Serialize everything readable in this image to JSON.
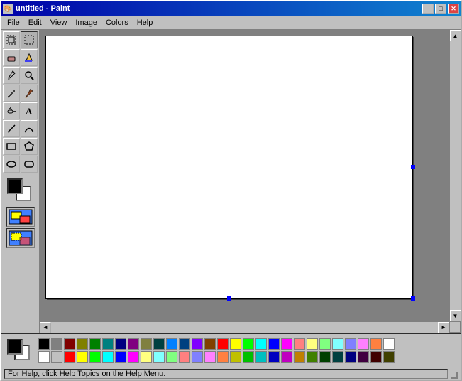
{
  "window": {
    "title": "untitled - Paint",
    "icon": "🎨"
  },
  "title_buttons": {
    "minimize": "—",
    "maximize": "□",
    "close": "✕"
  },
  "menu": {
    "items": [
      "File",
      "Edit",
      "View",
      "Image",
      "Colors",
      "Help"
    ]
  },
  "tools": [
    {
      "name": "free-select",
      "icon": "⬡",
      "title": "Free Select"
    },
    {
      "name": "rect-select",
      "icon": "⬜",
      "title": "Rectangular Select"
    },
    {
      "name": "eraser",
      "icon": "◻",
      "title": "Eraser"
    },
    {
      "name": "fill",
      "icon": "🪣",
      "title": "Fill"
    },
    {
      "name": "eyedropper",
      "icon": "💉",
      "title": "Pick Color"
    },
    {
      "name": "magnify",
      "icon": "🔍",
      "title": "Magnify"
    },
    {
      "name": "pencil",
      "icon": "✏",
      "title": "Pencil"
    },
    {
      "name": "brush",
      "icon": "🖌",
      "title": "Brush"
    },
    {
      "name": "airbrush",
      "icon": "💨",
      "title": "Airbrush"
    },
    {
      "name": "text",
      "icon": "A",
      "title": "Text"
    },
    {
      "name": "line",
      "icon": "╱",
      "title": "Line"
    },
    {
      "name": "curve",
      "icon": "∿",
      "title": "Curve"
    },
    {
      "name": "rect-shape",
      "icon": "▭",
      "title": "Rectangle"
    },
    {
      "name": "polygon",
      "icon": "⬠",
      "title": "Polygon"
    },
    {
      "name": "ellipse",
      "icon": "⬭",
      "title": "Ellipse"
    },
    {
      "name": "rounded-rect",
      "icon": "▢",
      "title": "Rounded Rectangle"
    }
  ],
  "active_tool": "rect-select",
  "foreground_color": "#000000",
  "background_color": "#ffffff",
  "palette_row1": [
    "#000000",
    "#808080",
    "#800000",
    "#808000",
    "#008000",
    "#008080",
    "#000080",
    "#800080",
    "#808040",
    "#004040",
    "#0080ff",
    "#004080",
    "#8000ff",
    "#804000",
    "#ff0000",
    "#ffff00",
    "#00ff00",
    "#00ffff",
    "#0000ff",
    "#ff00ff",
    "#ff8080",
    "#ffff80",
    "#80ff80",
    "#80ffff",
    "#8080ff",
    "#ff80ff",
    "#ff8040",
    "#ffffff"
  ],
  "palette_row2": [
    "#ffffff",
    "#c0c0c0",
    "#ff0000",
    "#ffff00",
    "#00ff00",
    "#00ffff",
    "#0000ff",
    "#ff00ff",
    "#ffff80",
    "#80ffff",
    "#80ff80",
    "#ff8080",
    "#8080ff",
    "#ff80ff",
    "#ff8040",
    "#c0c000",
    "#00c000",
    "#00c0c0",
    "#0000c0",
    "#c000c0",
    "#c08000",
    "#408000",
    "#004000",
    "#004040",
    "#000080",
    "#400040",
    "#400000",
    "#404000"
  ],
  "status_bar": {
    "help_text": "For Help, click Help Topics on the Help Menu."
  }
}
